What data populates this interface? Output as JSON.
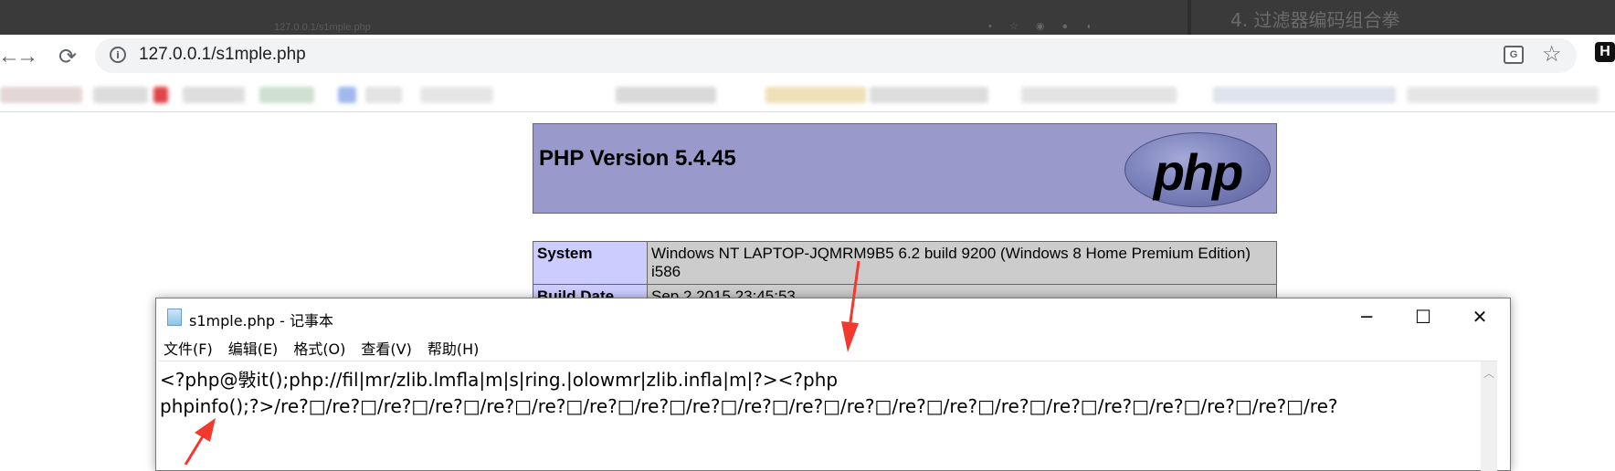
{
  "background": {
    "ghost_url": "127.0.0.1/s1mple.php",
    "doc_heading": "4. 过滤器编码组合拳"
  },
  "browser": {
    "back_icon": "←",
    "forward_icon": "→",
    "reload_icon": "⟳",
    "url": "127.0.0.1/s1mple.php",
    "info_icon": "i",
    "translate_icon": "G",
    "star_icon": "☆",
    "extension_label": "H"
  },
  "page": {
    "php_version_title": "PHP Version 5.4.45",
    "php_logo_text": "php",
    "table": [
      {
        "label": "System",
        "value": "Windows NT LAPTOP-JQMRM9B5 6.2 build 9200 (Windows 8 Home Premium Edition) i586"
      },
      {
        "label": "Build Date",
        "value": "Sep 2 2015 23:45:53"
      }
    ]
  },
  "notepad": {
    "title": "s1mple.php - 记事本",
    "minimize": "─",
    "maximize": "☐",
    "close": "✕",
    "menu": [
      "文件(F)",
      "编辑(E)",
      "格式(O)",
      "查看(V)",
      "帮助(H)"
    ],
    "content_line1": "<?php@斅it();php://fil|mr/zlib.lmfla|m|s|ring.|olowmr|zlib.infla|m|?><?php",
    "content_line2": "phpinfo();?>/re?□/re?□/re?□/re?□/re?□/re?□/re?□/re?□/re?□/re?□/re?□/re?□/re?□/re?□/re?□/re?□/re?□/re?□/re?□/re?□/re?"
  },
  "colors": {
    "php_header_bg": "#9999cc",
    "label_cell_bg": "#ccccff",
    "value_cell_bg": "#cccccc",
    "arrow": "#f03a2e"
  }
}
